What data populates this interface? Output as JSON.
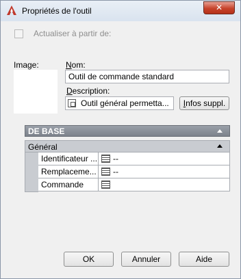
{
  "window": {
    "title": "Propriétés de l'outil",
    "close_label": "✕",
    "accent_color": "#c0392b"
  },
  "update_checkbox": {
    "label": "Actualiser à partir de:",
    "checked": false
  },
  "image": {
    "label": "Image:"
  },
  "name_field": {
    "label_accel": "N",
    "label_rest": "om:",
    "value": "Outil de commande standard"
  },
  "description_field": {
    "label_accel": "D",
    "label_rest": "escription:",
    "value": "Outil général permetta...",
    "icon": "description-icon"
  },
  "infos_button": {
    "label_accel": "I",
    "label_rest": "nfos suppl."
  },
  "properties_grid": {
    "category": "DE BASE",
    "subcategory": "Général",
    "rows": [
      {
        "name": "Identificateur ...",
        "value": "--",
        "icon": "grid-icon"
      },
      {
        "name": "Remplaceme...",
        "value": "--",
        "icon": "grid-icon"
      },
      {
        "name": "Commande",
        "value": "",
        "icon": "grid-icon"
      }
    ]
  },
  "buttons": {
    "ok": "OK",
    "cancel": "Annuler",
    "help": "Aide"
  }
}
